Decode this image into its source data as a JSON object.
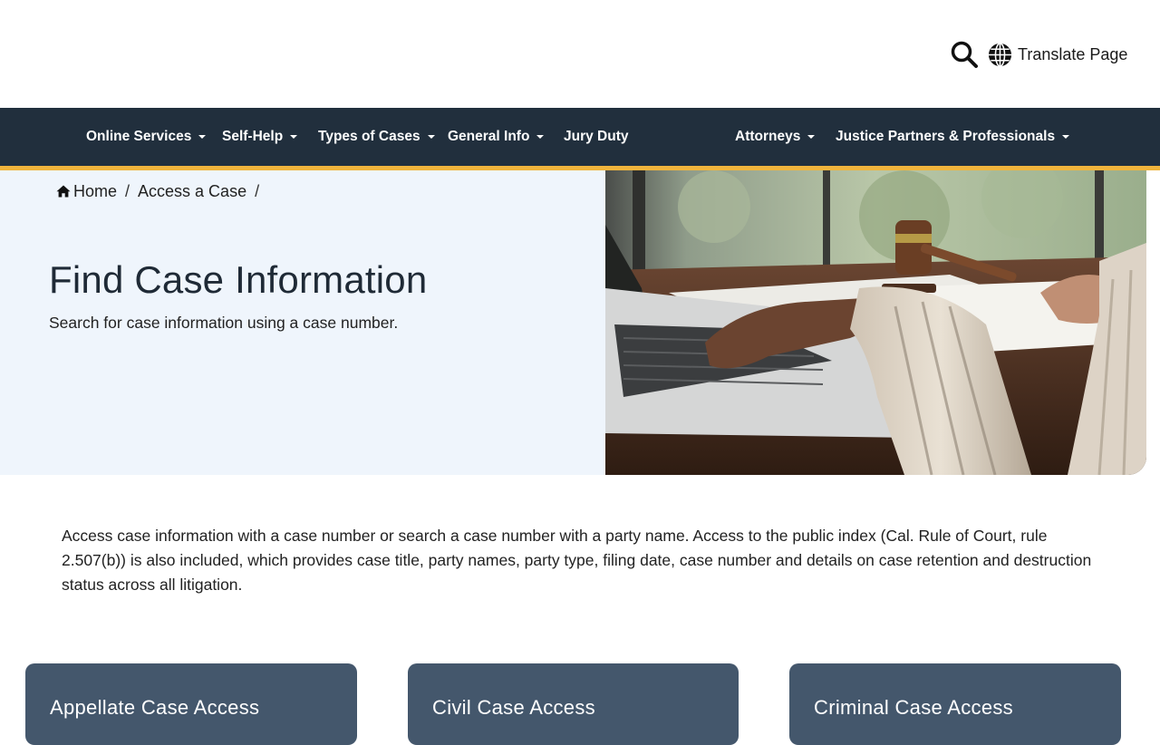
{
  "header": {
    "search_icon": "search-icon",
    "translate_icon": "globe-icon",
    "translate_label": "Translate Page"
  },
  "nav": {
    "items": [
      {
        "label": "Online Services",
        "dropdown": true
      },
      {
        "label": "Self-Help",
        "dropdown": true
      },
      {
        "label": "Types of Cases",
        "dropdown": true
      },
      {
        "label": "General Info",
        "dropdown": true
      },
      {
        "label": "Jury Duty",
        "dropdown": false
      },
      {
        "label": "Attorneys",
        "dropdown": true
      },
      {
        "label": "Justice Partners & Professionals",
        "dropdown": true
      }
    ],
    "background": "#212f3d",
    "accent": "#f0b43c"
  },
  "breadcrumb": {
    "items": [
      "Home",
      "Access a Case"
    ],
    "separator": "/"
  },
  "hero": {
    "title": "Find Case Information",
    "subtitle": "Search for case information using a case number.",
    "image_description_icon": "laptop-gavel-photo"
  },
  "intro": {
    "text": "Access case information with a case number or search a case number with a party name. Access to the public index (Cal. Rule of Court, rule 2.507(b)) is also included, which provides case title, party names, party type, filing date, case number and details on case retention and destruction status across all litigation."
  },
  "cards": [
    {
      "title": "Appellate Case Access"
    },
    {
      "title": "Civil Case Access"
    },
    {
      "title": "Criminal Case Access"
    }
  ],
  "colors": {
    "card": "#44576c",
    "hero_bg": "#eff5fc"
  }
}
